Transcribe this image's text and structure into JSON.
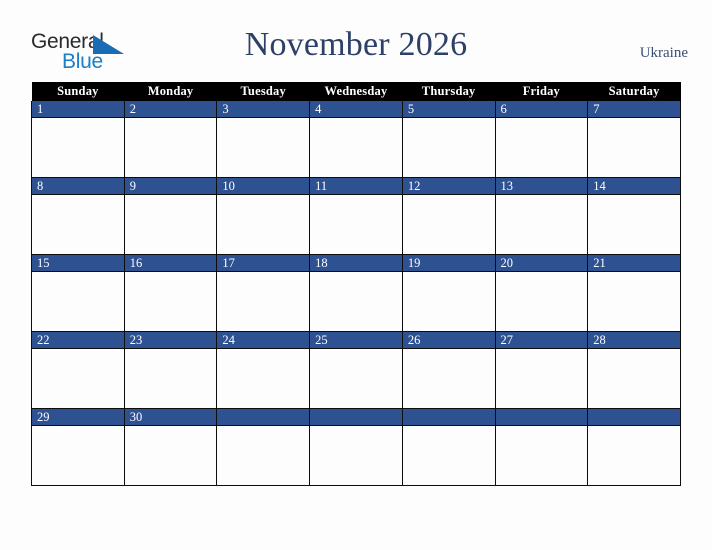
{
  "brand": {
    "line1": "General",
    "line2": "Blue",
    "triangle_icon": "triangle-icon",
    "color_dark": "#2b2b2b",
    "color_blue": "#1a7fc4"
  },
  "header": {
    "title": "November 2026",
    "country": "Ukraine",
    "title_color": "#2d4168",
    "country_color": "#3a4d73"
  },
  "calendar": {
    "weekday_headers": [
      "Sunday",
      "Monday",
      "Tuesday",
      "Wednesday",
      "Thursday",
      "Friday",
      "Saturday"
    ],
    "header_bg": "#000000",
    "header_text": "#ffffff",
    "daynum_bg": "#2e5192",
    "daynum_text": "#ffffff",
    "cell_bg": "#fdfdfd",
    "border_color": "#0d0d0d",
    "weeks": [
      {
        "days": [
          {
            "num": "1",
            "events": ""
          },
          {
            "num": "2",
            "events": ""
          },
          {
            "num": "3",
            "events": ""
          },
          {
            "num": "4",
            "events": ""
          },
          {
            "num": "5",
            "events": ""
          },
          {
            "num": "6",
            "events": ""
          },
          {
            "num": "7",
            "events": ""
          }
        ]
      },
      {
        "days": [
          {
            "num": "8",
            "events": ""
          },
          {
            "num": "9",
            "events": ""
          },
          {
            "num": "10",
            "events": ""
          },
          {
            "num": "11",
            "events": ""
          },
          {
            "num": "12",
            "events": ""
          },
          {
            "num": "13",
            "events": ""
          },
          {
            "num": "14",
            "events": ""
          }
        ]
      },
      {
        "days": [
          {
            "num": "15",
            "events": ""
          },
          {
            "num": "16",
            "events": ""
          },
          {
            "num": "17",
            "events": ""
          },
          {
            "num": "18",
            "events": ""
          },
          {
            "num": "19",
            "events": ""
          },
          {
            "num": "20",
            "events": ""
          },
          {
            "num": "21",
            "events": ""
          }
        ]
      },
      {
        "days": [
          {
            "num": "22",
            "events": ""
          },
          {
            "num": "23",
            "events": ""
          },
          {
            "num": "24",
            "events": ""
          },
          {
            "num": "25",
            "events": ""
          },
          {
            "num": "26",
            "events": ""
          },
          {
            "num": "27",
            "events": ""
          },
          {
            "num": "28",
            "events": ""
          }
        ]
      },
      {
        "days": [
          {
            "num": "29",
            "events": ""
          },
          {
            "num": "30",
            "events": ""
          },
          {
            "num": "",
            "events": ""
          },
          {
            "num": "",
            "events": ""
          },
          {
            "num": "",
            "events": ""
          },
          {
            "num": "",
            "events": ""
          },
          {
            "num": "",
            "events": ""
          }
        ]
      }
    ]
  }
}
